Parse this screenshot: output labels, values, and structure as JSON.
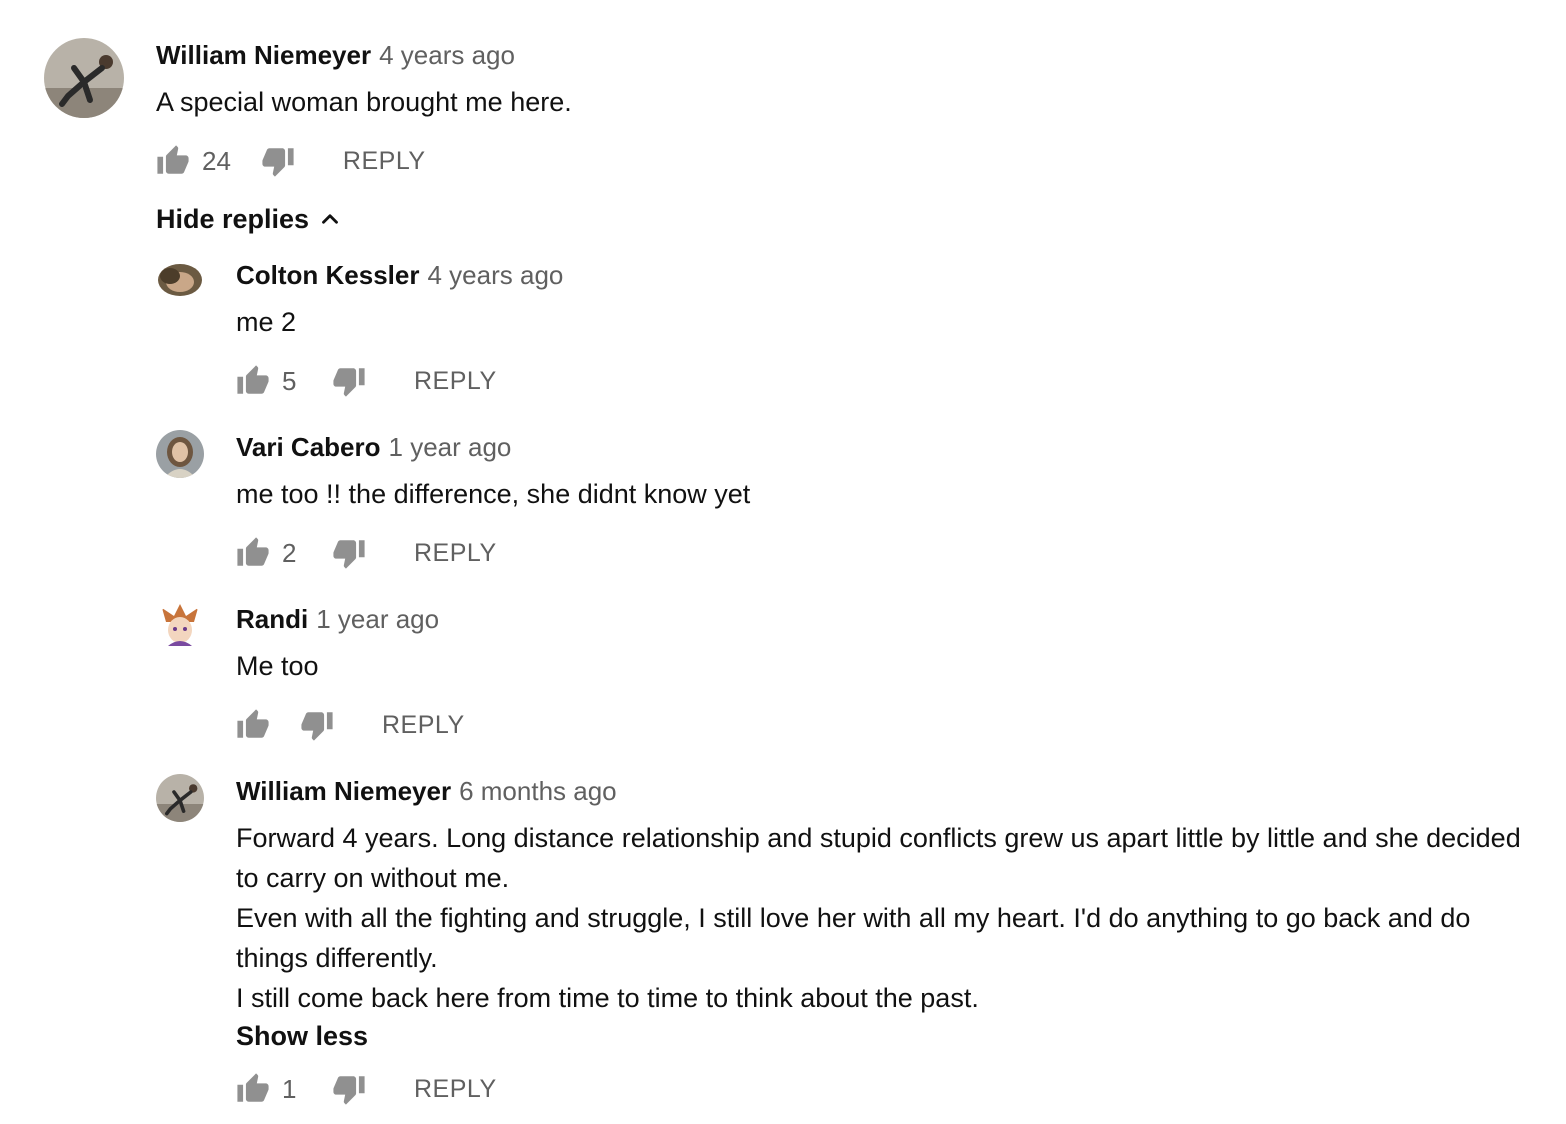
{
  "top_comment": {
    "author": "William Niemeyer",
    "time": "4 years ago",
    "text": "A special woman brought me here.",
    "likes": "24",
    "reply_label": "REPLY",
    "avatar_icon": "avatar-photo"
  },
  "hide_replies_label": "Hide replies",
  "replies": [
    {
      "author": "Colton Kessler",
      "time": "4 years ago",
      "text": "me 2",
      "likes": "5",
      "reply_label": "REPLY"
    },
    {
      "author": "Vari Cabero",
      "time": "1 year ago",
      "text": "me too !! the difference, she didnt know yet",
      "likes": "2",
      "reply_label": "REPLY"
    },
    {
      "author": "Randi",
      "time": "1 year ago",
      "text": "Me too",
      "likes": "",
      "reply_label": "REPLY"
    },
    {
      "author": "William Niemeyer",
      "time": "6 months ago",
      "text_lines": [
        "Forward 4 years. Long distance relationship and stupid conflicts grew us apart little by little and she decided to carry on without me.",
        "Even with all the fighting and struggle, I still love her with all my heart. I'd do anything to go back and do things differently.",
        "I still come back here from time to time to think about the past."
      ],
      "show_less_label": "Show less",
      "likes": "1",
      "reply_label": "REPLY"
    }
  ],
  "colors": {
    "text": "#111111",
    "secondary": "#606060",
    "icon": "#909090"
  }
}
